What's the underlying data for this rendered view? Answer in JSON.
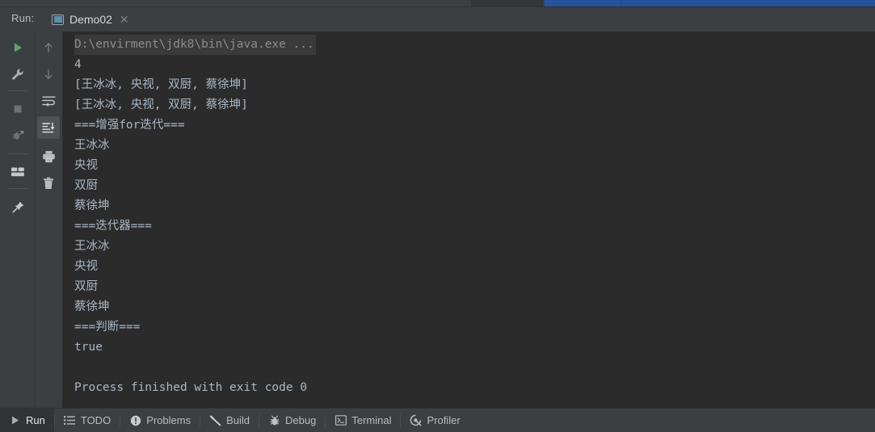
{
  "window": {
    "background_color": "#2b2b2b",
    "chrome_color": "#3c3f41",
    "accent_blue": "#27529c"
  },
  "header": {
    "run_label": "Run:",
    "tab": {
      "icon": "run-configuration-icon",
      "title": "Demo02",
      "close_icon": "close-icon"
    }
  },
  "toolbar_left": {
    "items": [
      {
        "name": "rerun-button",
        "icon": "play-icon",
        "label": "Rerun"
      },
      {
        "name": "edit-configurations-button",
        "icon": "wrench-icon",
        "label": "Edit Configurations"
      },
      {
        "name": "stop-button",
        "icon": "stop-square-icon",
        "label": "Stop"
      },
      {
        "name": "attach-debugger-button",
        "icon": "bug-attach-icon",
        "label": "Attach Debugger"
      },
      {
        "name": "layout-settings-button",
        "icon": "layout-icon",
        "label": "Layout Settings"
      },
      {
        "name": "pin-tab-button",
        "icon": "pin-icon",
        "label": "Pin Tab"
      }
    ]
  },
  "toolbar_right": {
    "items": [
      {
        "name": "up-the-stack-trace-button",
        "icon": "arrow-up-icon",
        "label": "Up the Stack Trace"
      },
      {
        "name": "down-the-stack-trace-button",
        "icon": "arrow-down-icon",
        "label": "Down the Stack Trace"
      },
      {
        "name": "soft-wrap-button",
        "icon": "soft-wrap-icon",
        "label": "Soft-Wrap"
      },
      {
        "name": "scroll-to-end-button",
        "icon": "scroll-to-end-icon",
        "label": "Scroll to the End",
        "selected": true
      },
      {
        "name": "print-button",
        "icon": "printer-icon",
        "label": "Print"
      },
      {
        "name": "clear-all-button",
        "icon": "trash-icon",
        "label": "Clear All"
      }
    ]
  },
  "console": {
    "lines": [
      {
        "text": "D:\\envirment\\jdk8\\bin\\java.exe ...",
        "style": "cmdline"
      },
      {
        "text": "4",
        "style": "normal"
      },
      {
        "text": "[王冰冰, 央视, 双厨, 蔡徐坤]",
        "style": "normal"
      },
      {
        "text": "[王冰冰, 央视, 双厨, 蔡徐坤]",
        "style": "normal"
      },
      {
        "text": "===增强for迭代===",
        "style": "normal"
      },
      {
        "text": "王冰冰",
        "style": "normal"
      },
      {
        "text": "央视",
        "style": "normal"
      },
      {
        "text": "双厨",
        "style": "normal"
      },
      {
        "text": "蔡徐坤",
        "style": "normal"
      },
      {
        "text": "===迭代器===",
        "style": "normal"
      },
      {
        "text": "王冰冰",
        "style": "normal"
      },
      {
        "text": "央视",
        "style": "normal"
      },
      {
        "text": "双厨",
        "style": "normal"
      },
      {
        "text": "蔡徐坤",
        "style": "normal"
      },
      {
        "text": "===判断===",
        "style": "normal"
      },
      {
        "text": "true",
        "style": "normal"
      },
      {
        "text": "",
        "style": "blank"
      },
      {
        "text": "Process finished with exit code 0",
        "style": "normal"
      }
    ]
  },
  "statusbar": {
    "items": [
      {
        "name": "status-run",
        "icon": "play-icon",
        "label": "Run",
        "active": true
      },
      {
        "name": "status-todo",
        "icon": "list-icon",
        "label": "TODO",
        "active": false
      },
      {
        "name": "status-problems",
        "icon": "exclamation-circle-icon",
        "label": "Problems",
        "active": false
      },
      {
        "name": "status-build",
        "icon": "hammer-icon",
        "label": "Build",
        "active": false
      },
      {
        "name": "status-debug",
        "icon": "bug-icon",
        "label": "Debug",
        "active": false
      },
      {
        "name": "status-terminal",
        "icon": "terminal-icon",
        "label": "Terminal",
        "active": false
      },
      {
        "name": "status-profiler",
        "icon": "profiler-icon",
        "label": "Profiler",
        "active": false
      }
    ]
  }
}
